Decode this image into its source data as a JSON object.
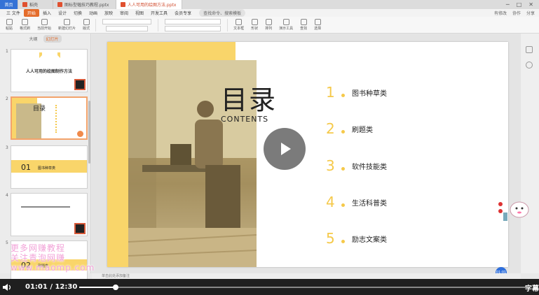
{
  "titlebar": {
    "tabs": [
      {
        "label": "首页"
      },
      {
        "label": "稻壳"
      },
      {
        "label": "图标型幅技巧教程.pptx"
      },
      {
        "label": "人人可用的绘图方法.pptx"
      }
    ]
  },
  "menubar": {
    "items": [
      "三 文件",
      "开始",
      "插入",
      "设计",
      "切换",
      "动画",
      "放映",
      "审阅",
      "视图",
      "开发工具",
      "会员专享"
    ],
    "selected": "开始",
    "search_label": "查找命令、搜索模板",
    "right_items": [
      "有修改",
      "协作",
      "分享"
    ]
  },
  "ribbon": {
    "groups": [
      "粘贴",
      "格式刷",
      "当前开始",
      "新建幻灯片",
      "版式",
      "节",
      "重置",
      "文本框",
      "形状",
      "排列",
      "演示工具",
      "查找",
      "替换",
      "选择"
    ]
  },
  "sidebar": {
    "tabs": [
      "大纲",
      "幻灯片"
    ],
    "active_tab": "幻灯片",
    "slides": [
      {
        "num": "1",
        "title": "人人可用的绘图制作方法"
      },
      {
        "num": "2",
        "title": "目录"
      },
      {
        "num": "3",
        "title": "01",
        "subtitle": "图书种草类"
      },
      {
        "num": "4",
        "title": ""
      },
      {
        "num": "5",
        "title": "02",
        "subtitle": "刷题类"
      }
    ]
  },
  "slide": {
    "title": "目录",
    "subtitle": "CONTENTS",
    "items": [
      {
        "num": "1",
        "text": "图书种草类"
      },
      {
        "num": "2",
        "text": "刷题类"
      },
      {
        "num": "3",
        "text": "软件技能类"
      },
      {
        "num": "4",
        "text": "生活科普类"
      },
      {
        "num": "5",
        "text": "励志文案类"
      }
    ]
  },
  "notes": {
    "placeholder": "单击此处添加备注"
  },
  "watermark": {
    "lines": [
      "更多网赚教程",
      "关注青泡网赚",
      "www.maomp.com"
    ]
  },
  "video": {
    "current": "01:01",
    "separator": "/",
    "total": "12:30",
    "progress": 0.081,
    "caption_label": "字幕"
  },
  "time_badge": "01:01",
  "colors": {
    "accent": "#e46c2b",
    "yellow": "#f9d56a",
    "number": "#f5c94a"
  }
}
